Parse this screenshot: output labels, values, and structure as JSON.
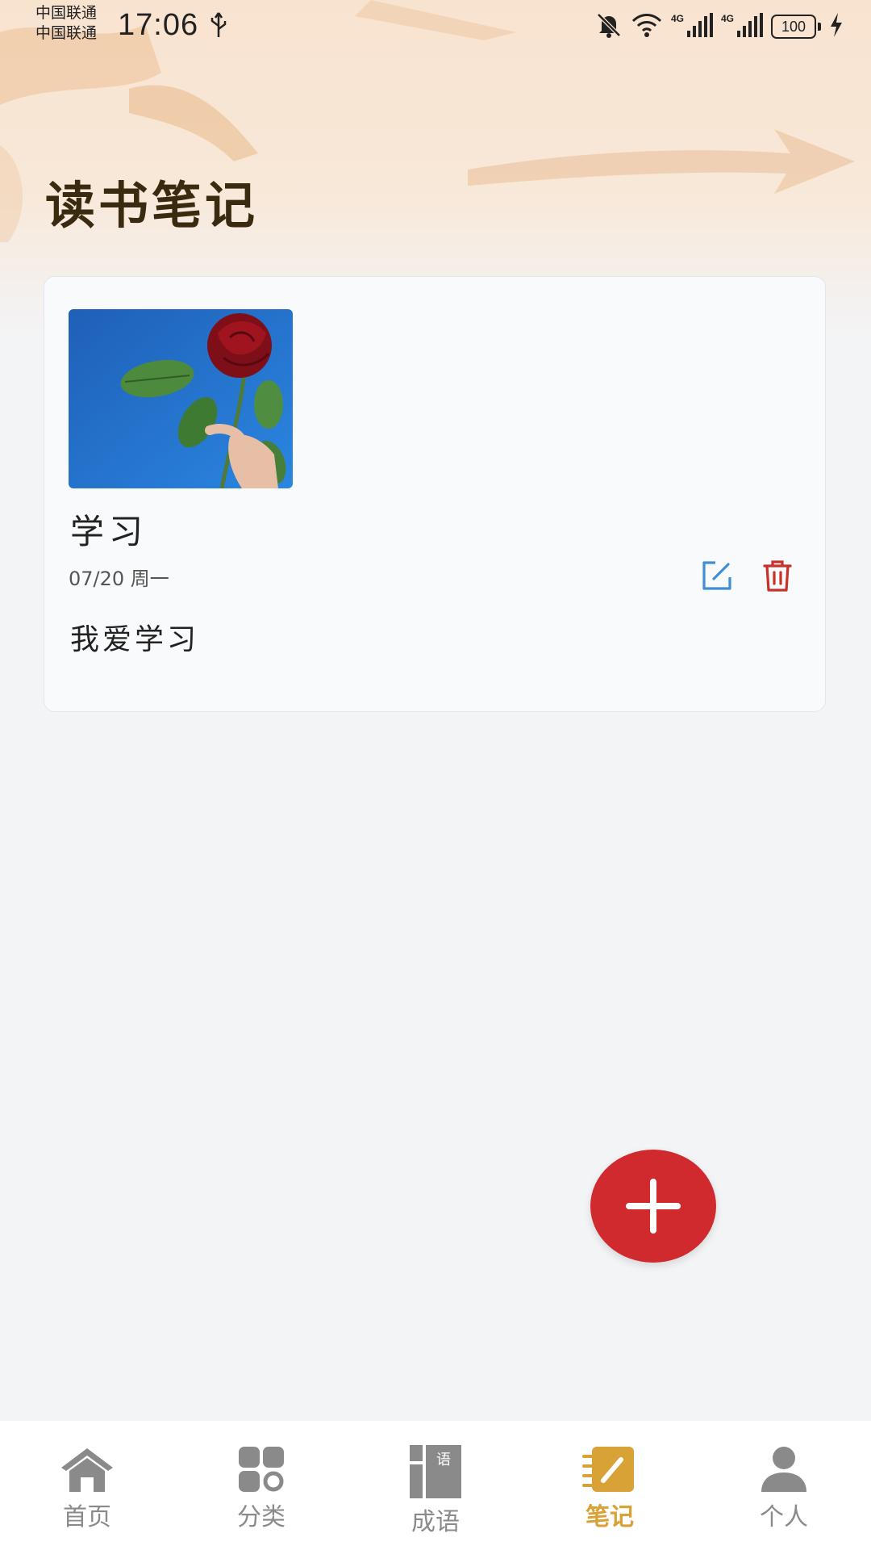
{
  "status_bar": {
    "carrier_1": "中国联通",
    "carrier_2": "中国联通",
    "time": "17:06",
    "network_1": "4G",
    "network_2": "4G",
    "battery": "100",
    "icons": [
      "usb-icon",
      "bell-muted-icon",
      "wifi-icon",
      "signal-icon",
      "signal-icon",
      "battery-icon",
      "charging-icon"
    ]
  },
  "header": {
    "title": "读书笔记"
  },
  "notes": [
    {
      "title": "学习",
      "date": "07/20 周一",
      "body": "我爱学习",
      "image": "rose-photo"
    }
  ],
  "fab": {
    "icon": "plus-icon"
  },
  "tab_bar": {
    "items": [
      {
        "label": "首页",
        "icon": "home-icon"
      },
      {
        "label": "分类",
        "icon": "category-icon"
      },
      {
        "label": "成语",
        "icon": "idiom-book-icon"
      },
      {
        "label": "笔记",
        "icon": "notes-icon",
        "active": true
      },
      {
        "label": "个人",
        "icon": "person-icon"
      }
    ]
  },
  "colors": {
    "accent": "#d9a236",
    "fab": "#d12a2e",
    "edit": "#3f8fd8",
    "delete": "#c8302a",
    "inactive_tab": "#8a8a8a"
  }
}
